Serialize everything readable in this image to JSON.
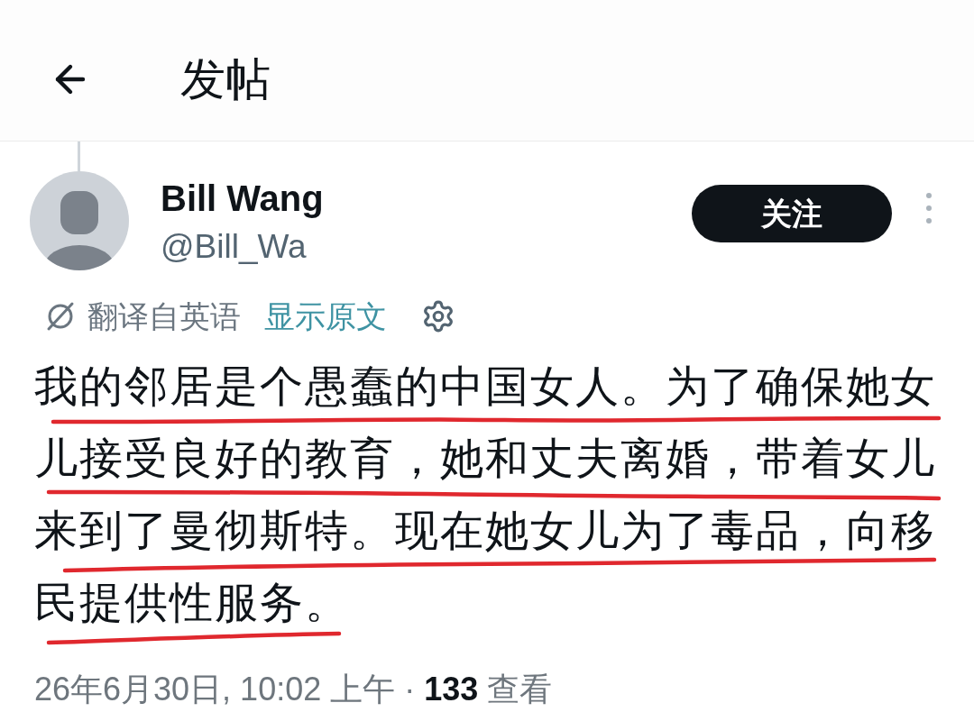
{
  "header": {
    "title": "发帖"
  },
  "post": {
    "author": {
      "name": "Bill Wang",
      "handle": "@Bill_Wa"
    },
    "follow_button": {
      "label": "关注"
    },
    "translation": {
      "note": "翻译自英语",
      "link": "显示原文"
    },
    "text_lines": [
      "我的邻居是个愚蠢的中国女人。为了确保她女",
      "儿接受良好的教育，她和丈夫离婚，带着女儿",
      "来到了曼彻斯特。现在她女儿为了毒品，向移",
      "民提供性服务。"
    ],
    "meta": "26年6月30日, 10:02 上午 · **133** 查看"
  }
}
